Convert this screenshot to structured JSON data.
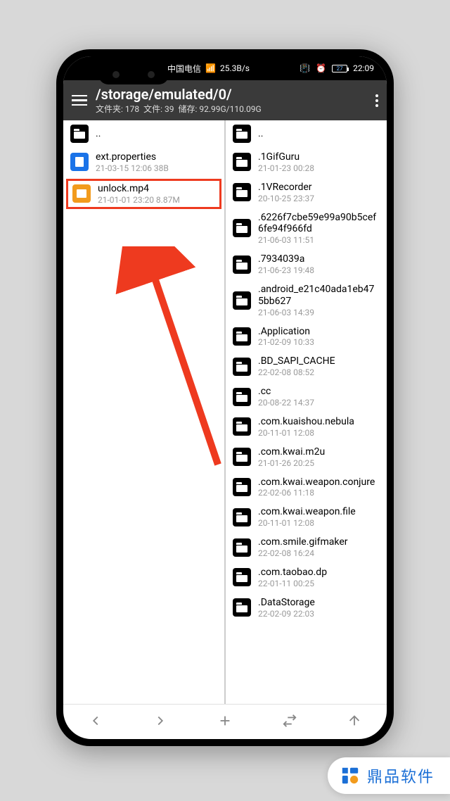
{
  "statusbar": {
    "carrier": "中国电信",
    "net_speed": "25.3B/s",
    "battery": "27",
    "time": "22:09"
  },
  "appbar": {
    "path": "/storage/emulated/0/",
    "sub_folders_label": "文件夹:",
    "sub_folders_count": "178",
    "sub_files_label": "文件:",
    "sub_files_count": "39",
    "sub_storage_label": "储存:",
    "sub_storage_value": "92.99G/110.09G"
  },
  "left_pane": {
    "parent": "..",
    "items": [
      {
        "icon": "doc",
        "name": "ext.properties",
        "meta": "21-03-15 12:06  38B"
      },
      {
        "icon": "video",
        "name": "unlock.mp4",
        "meta": "21-01-01 23:20  8.87M",
        "highlight": true
      }
    ]
  },
  "right_pane": {
    "parent": "..",
    "items": [
      {
        "name": ".1GifGuru",
        "meta": "21-01-23 00:28"
      },
      {
        "name": ".1VRecorder",
        "meta": "20-10-25 23:37"
      },
      {
        "name": ".6226f7cbe59e99a90b5cef6fe94f966fd",
        "meta": "21-06-03 11:51"
      },
      {
        "name": ".7934039a",
        "meta": "21-06-23 19:48"
      },
      {
        "name": ".android_e21c40ada1eb475bb627",
        "meta": "21-06-03 14:39"
      },
      {
        "name": ".Application",
        "meta": "21-02-09 10:33"
      },
      {
        "name": ".BD_SAPI_CACHE",
        "meta": "22-02-08 08:52"
      },
      {
        "name": ".cc",
        "meta": "20-08-22 14:37"
      },
      {
        "name": ".com.kuaishou.nebula",
        "meta": "20-11-01 12:08"
      },
      {
        "name": ".com.kwai.m2u",
        "meta": "21-01-26 20:25"
      },
      {
        "name": ".com.kwai.weapon.conjure",
        "meta": "22-02-06 11:18"
      },
      {
        "name": ".com.kwai.weapon.file",
        "meta": "20-11-01 12:08"
      },
      {
        "name": ".com.smile.gifmaker",
        "meta": "22-02-08 16:24"
      },
      {
        "name": ".com.taobao.dp",
        "meta": "22-01-11 00:25"
      },
      {
        "name": ".DataStorage",
        "meta": "22-02-09 22:03"
      }
    ]
  },
  "watermark": {
    "text": "鼎品软件"
  }
}
